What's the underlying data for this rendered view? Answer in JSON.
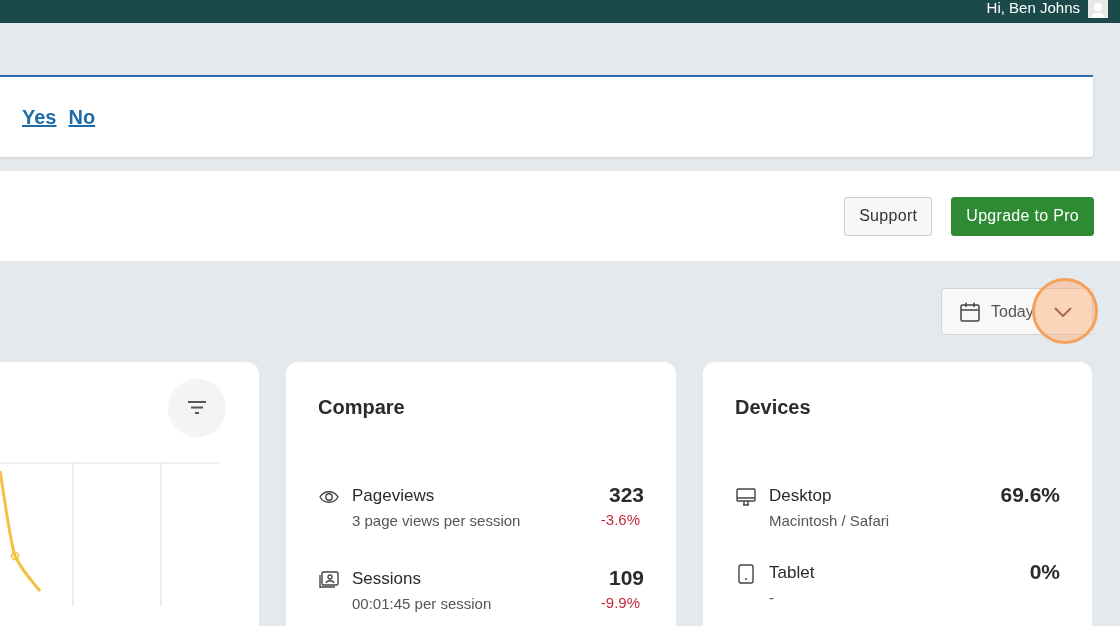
{
  "top_bar": {
    "greeting": "Hi, Ben Johns"
  },
  "notice": {
    "links": [
      "Yes",
      "No"
    ]
  },
  "header": {
    "buttons": [
      {
        "label": "Support",
        "kind": "secondary"
      },
      {
        "label": "Upgrade to Pro",
        "kind": "primary"
      }
    ]
  },
  "date_picker": {
    "value": "Today"
  },
  "compare": {
    "title": "Compare",
    "rows": [
      {
        "kind": "eye",
        "label": "Pageviews",
        "sub": "3 page views per session",
        "value": "323",
        "change": "-3.6%"
      },
      {
        "kind": "sessions",
        "label": "Sessions",
        "sub": "00:01:45 per session",
        "value": "109",
        "change": "-9.9%"
      }
    ]
  },
  "devices": {
    "title": "Devices",
    "rows": [
      {
        "kind": "desktop",
        "label": "Desktop",
        "sub": "Macintosh / Safari",
        "value": "69.6%"
      },
      {
        "kind": "tablet",
        "label": "Tablet",
        "sub": "-",
        "value": "0%"
      }
    ]
  }
}
